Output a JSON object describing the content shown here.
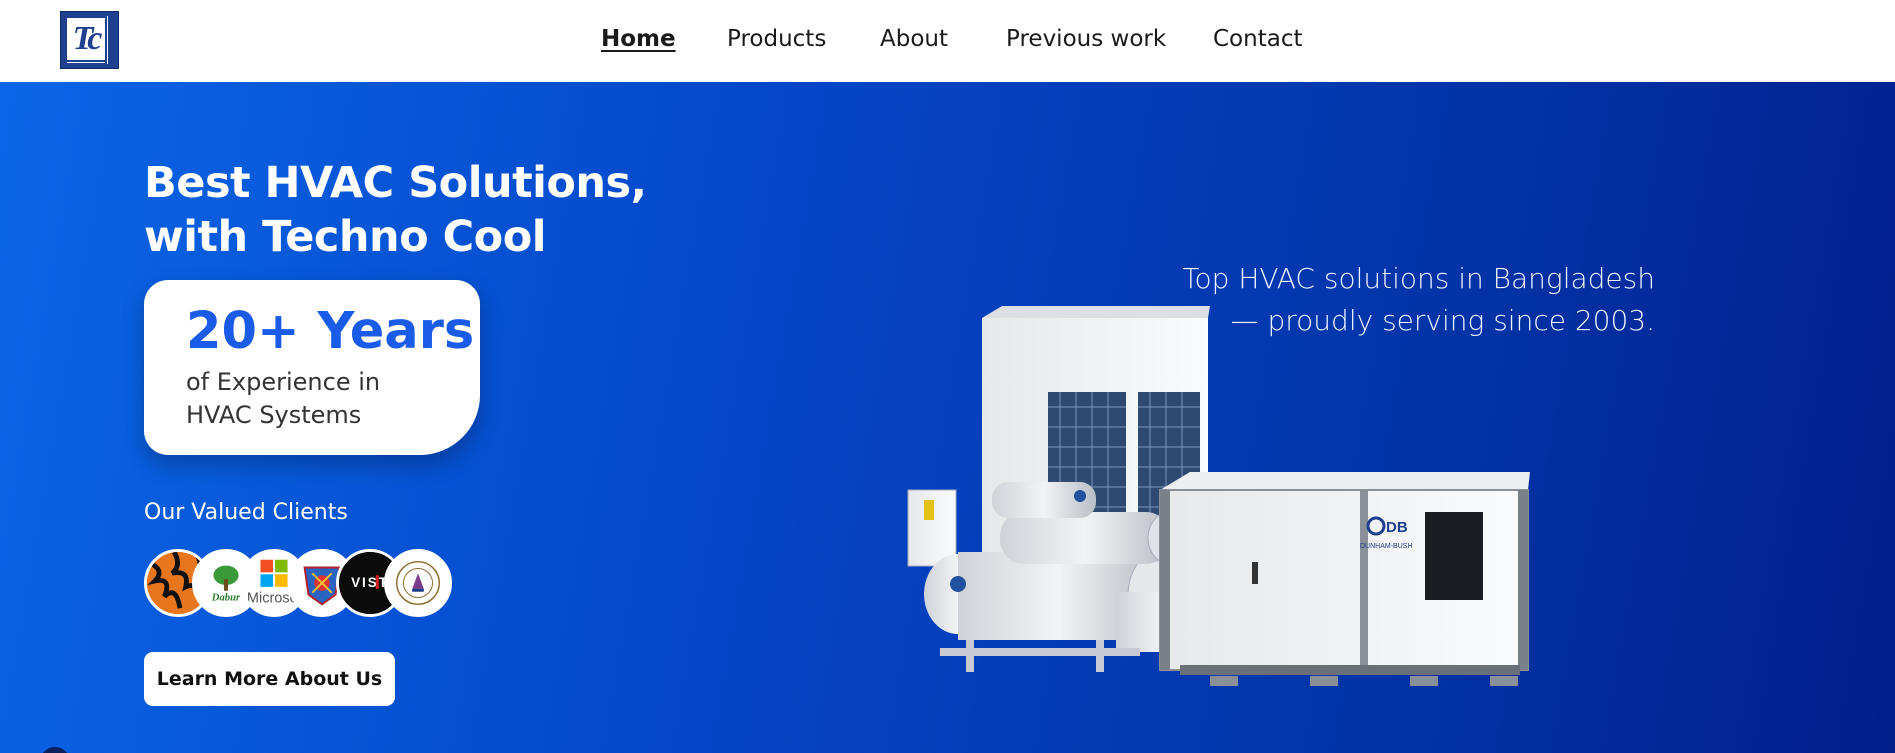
{
  "header": {
    "logo_letters": "Tc",
    "nav": [
      {
        "label": "Home",
        "active": true
      },
      {
        "label": "Products",
        "active": false
      },
      {
        "label": "About",
        "active": false
      },
      {
        "label": "Previous work",
        "active": false
      },
      {
        "label": "Contact",
        "active": false
      }
    ]
  },
  "hero": {
    "title_line1": "Best HVAC Solutions,",
    "title_line2": "with Techno Cool",
    "experience": {
      "headline": "20+ Years",
      "line1": "of Experience in",
      "line2": "HVAC Systems"
    },
    "clients_label": "Our Valued Clients",
    "clients": [
      "tiger-logo",
      "dabur-logo",
      "microsoft-logo",
      "army-crest-logo",
      "vist-logo",
      "university-seal-logo"
    ],
    "clients_visible_text": [
      "Dabur",
      "Microso",
      "VIST"
    ],
    "cta_label": "Learn More About Us",
    "tagline_line1": "Top HVAC solutions in Bangladesh",
    "tagline_line2": "— proudly serving since 2003.",
    "product_brand": "DB",
    "product_brand_sub": "DUNHAM-BUSH"
  },
  "colors": {
    "accent": "#1a5be8",
    "hero_gradient_start": "#0a66e6",
    "hero_gradient_end": "#021f8c",
    "logo_bg": "#1f3f8f"
  }
}
